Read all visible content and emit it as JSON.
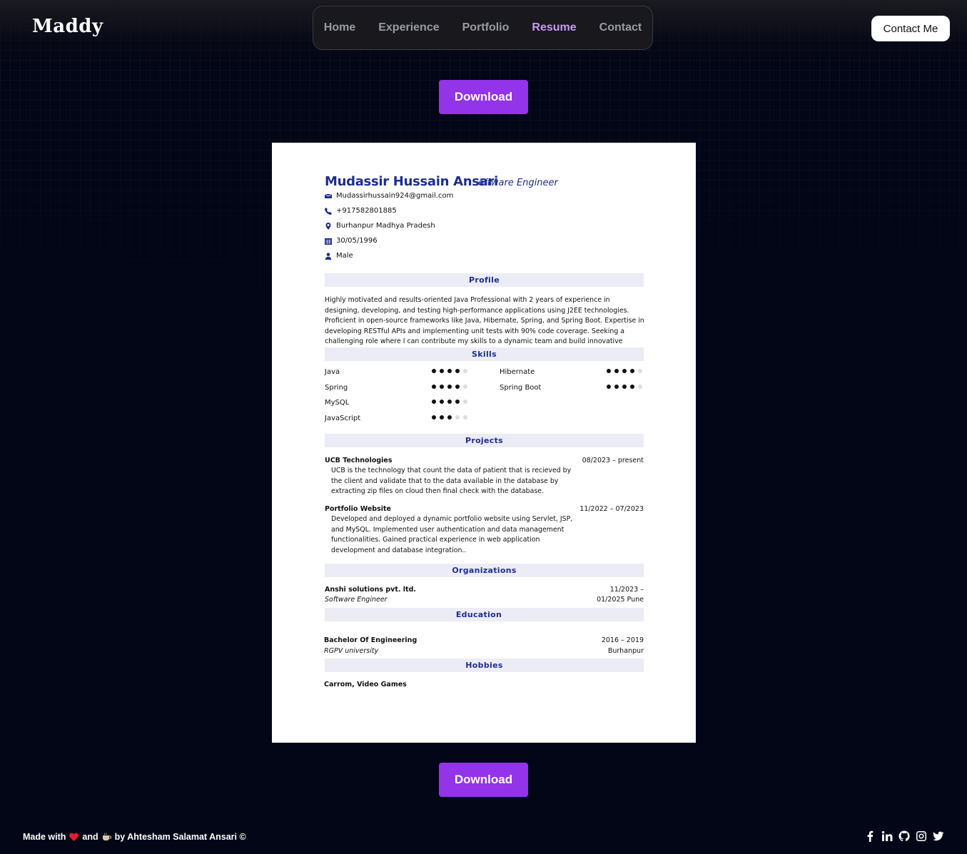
{
  "header": {
    "logo": "Maddy",
    "nav": [
      {
        "label": "Home"
      },
      {
        "label": "Experience"
      },
      {
        "label": "Portfolio"
      },
      {
        "label": "Resume",
        "active": true
      },
      {
        "label": "Contact"
      }
    ],
    "contact_button": "Contact Me"
  },
  "download_top": "Download",
  "download_bottom": "Download",
  "resume": {
    "name": "Mudassir Hussain Ansari",
    "role": "Software Engineer",
    "contacts": {
      "email": "Mudassirhussain924@gmail.com",
      "phone": "+917582801885",
      "location": "Burhanpur Madhya Pradesh",
      "dob": "30/05/1996",
      "gender": "Male"
    },
    "profile_heading": "Profile",
    "profile_text": "Highly motivated and results-oriented Java Professional with 2 years of experience in designing, developing, and testing high-performance applications using J2EE technologies. Proficient in open-source frameworks like Java, Hibernate, Spring, and Spring Boot. Expertise in developing RESTful APIs and implementing unit tests with 90% code coverage. Seeking a challenging role where I can contribute my skills to a dynamic team and build innovative solutions.",
    "skills_heading": "Skills",
    "skills": [
      {
        "name": "Java",
        "level": 4
      },
      {
        "name": "Hibernate",
        "level": 4
      },
      {
        "name": "Spring",
        "level": 4
      },
      {
        "name": "Spring Boot",
        "level": 4
      },
      {
        "name": "MySQL",
        "level": 4
      },
      {
        "name": "JavaScript",
        "level": 3
      }
    ],
    "projects_heading": "Projects",
    "projects": [
      {
        "title": "UCB Technologies",
        "date": "08/2023 – present",
        "desc": "UCB is the technology that count the data of patient that is recieved by the client and validate that to the data available in the database by extracting zip files on cloud then final check with the database."
      },
      {
        "title": "Portfolio Website",
        "date": "11/2022 – 07/2023",
        "desc": "Developed and deployed a dynamic portfolio website using Servlet, JSP, and MySQL. Implemented user authentication and data management functionalities. Gained practical experience in web application development and database integration.."
      }
    ],
    "organizations_heading": "Organizations",
    "organization": {
      "name": "Anshi solutions pvt. ltd.",
      "role": "Software Engineer",
      "date1": "11/2023 –",
      "date2": "01/2025 Pune"
    },
    "education_heading": "Education",
    "education": {
      "degree": "Bachelor Of Engineering",
      "school": "RGPV university",
      "years": "2016 – 2019",
      "place": "Burhanpur"
    },
    "hobbies_heading": "Hobbies",
    "hobbies": "Carrom, Video Games"
  },
  "footer": {
    "made_with": "Made with",
    "and": "and",
    "by": "by Ahtesham Salamat Ansari ©",
    "socials": [
      "facebook-icon",
      "linkedin-icon",
      "github-icon",
      "instagram-icon",
      "twitter-icon"
    ]
  }
}
